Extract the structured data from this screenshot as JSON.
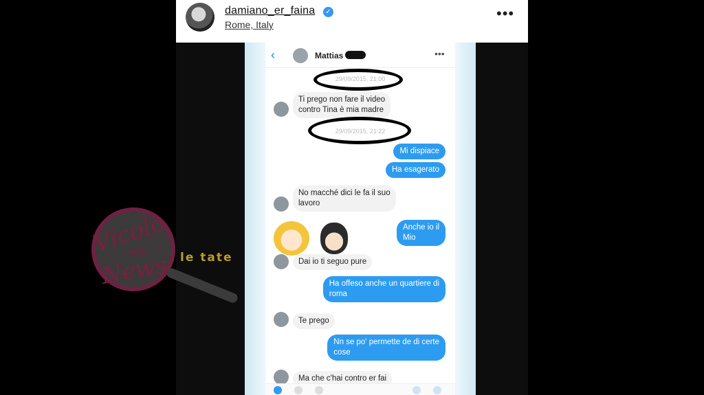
{
  "post": {
    "username": "damiano_er_faina",
    "location": "Rome, Italy",
    "more_icon": "more-dots-icon",
    "verified_icon": "verified-badge-icon"
  },
  "chat": {
    "contact_name": "Mattias",
    "timestamps": [
      "29/09/2015, 21:00",
      "29/09/2015, 21:22"
    ],
    "messages": [
      {
        "dir": "in",
        "text": "Ti prego non fare il video\ncontro Tina è mia madre"
      },
      {
        "dir": "out",
        "text": "Mi dispiace"
      },
      {
        "dir": "out",
        "text": "Ha esagerato"
      },
      {
        "dir": "in",
        "text": "No macché dici le fa il suo\nlavoro"
      },
      {
        "dir": "out",
        "text": "Anche io il\nMio"
      },
      {
        "dir": "in",
        "text": "Dai io ti seguo pure"
      },
      {
        "dir": "out",
        "text": "Ha offeso anche un quartiere di\nroma"
      },
      {
        "dir": "in",
        "text": "Te prego"
      },
      {
        "dir": "out",
        "text": "Nn se po' permette de di certe\ncose"
      },
      {
        "dir": "in",
        "text": "Ma che c'hai contro er fai"
      }
    ]
  },
  "watermark": {
    "line1": "Vicolo",
    "line2": "delle",
    "line3": "News",
    "line4": "le tate"
  },
  "colors": {
    "outgoing_bubble": "#2d9cf0",
    "incoming_bubble": "#f2f2f2",
    "verified": "#3897f0",
    "watermark_primary": "#7a1f3d"
  }
}
